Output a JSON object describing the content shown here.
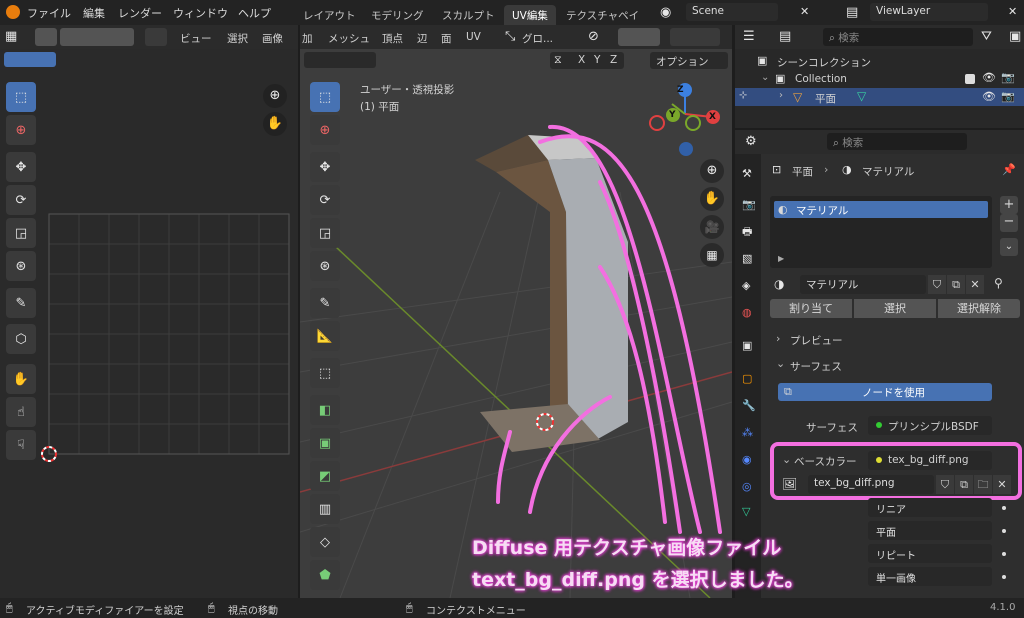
{
  "topmenu": {
    "file": "ファイル",
    "edit": "編集",
    "render": "レンダー",
    "window": "ウィンドウ",
    "help": "ヘルプ"
  },
  "workspaces": [
    "レイアウト",
    "モデリング",
    "スカルプト",
    "UV編集",
    "テクスチャペイン"
  ],
  "scene": {
    "label": "Scene"
  },
  "viewlayer": {
    "label": "ViewLayer"
  },
  "uv_header": {
    "view": "ビュー",
    "select": "選択",
    "image": "画像"
  },
  "vp_header": {
    "add": "加",
    "mesh": "メッシュ",
    "vertex": "頂点",
    "edge": "辺",
    "face": "面",
    "uv": "UV",
    "transform": "グロ..."
  },
  "vp_overlay": {
    "x": "X",
    "y": "Y",
    "z": "Z",
    "options": "オプション"
  },
  "viewport": {
    "title": "ユーザー・透視投影",
    "subtitle": "(1) 平面"
  },
  "gizmo": {
    "z": "Z",
    "y": "Y",
    "x": "X"
  },
  "outliner": {
    "search_placeholder": "検索",
    "scene_collection": "シーンコレクション",
    "collection": "Collection",
    "object": "平面"
  },
  "properties": {
    "search_placeholder": "検索",
    "breadcrumb_object": "平面",
    "breadcrumb_material": "マテリアル",
    "slot_name": "マテリアル",
    "material_name": "マテリアル",
    "assign": "割り当て",
    "select": "選択",
    "deselect": "選択解除",
    "preview": "プレビュー",
    "surface_section": "サーフェス",
    "use_nodes": "ノードを使用",
    "surface_label": "サーフェス",
    "surface_value": "プリンシプルBSDF",
    "base_color_label": "ベースカラー",
    "base_color_value": "tex_bg_diff.png",
    "image_name": "tex_bg_diff.png",
    "interp": "リニア",
    "projection": "平面",
    "extension": "リピート",
    "source": "単一画像"
  },
  "status": {
    "left": "アクティブモディファイアーを設定",
    "mid": "視点の移動",
    "ctx": "コンテクストメニュー",
    "version": "4.1.0"
  },
  "annotation": {
    "line1": "Diffuse 用テクスチャ画像ファイル",
    "line2": "text_bg_diff.png を選択しました。"
  },
  "colors": {
    "accent": "#4772b3",
    "highlight": "#f36fe0",
    "active_row": "#334d80"
  }
}
